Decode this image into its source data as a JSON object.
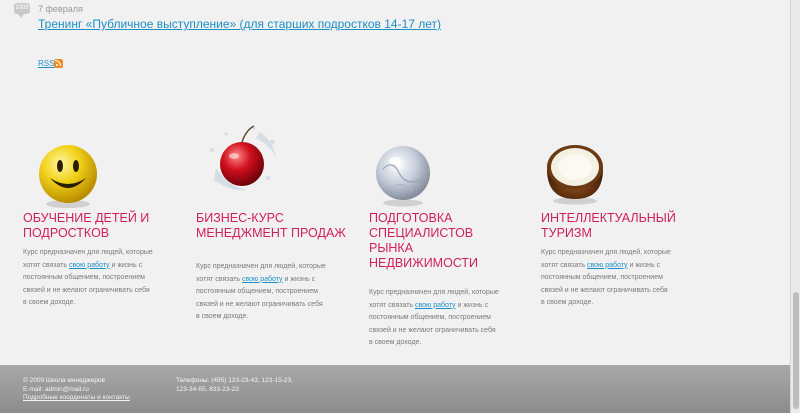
{
  "news": {
    "badge": "2009",
    "date": "7 февраля",
    "title": "Тренинг «Публичное выступление» (для старших подростков 14-17 лет)"
  },
  "rss": {
    "label": "RSS",
    "icon": "rss-icon"
  },
  "courses": [
    {
      "icon": "smiley-ball-icon",
      "title": "Обучение детей и подростков",
      "text_before": "Курс предназначен для людей, которые хотят связать ",
      "link": "свою работу",
      "text_after": " и жизнь с постоянным общением, построением связей и не желают ограничивать себя в своем доходе."
    },
    {
      "icon": "cherry-splash-icon",
      "title": "Бизнес-курс менеджмент продаж",
      "text_before": "Курс предназначен для людей, которые хотят связать ",
      "link": "свою работу",
      "text_after": " и жизнь с постоянным общением, построением связей и не желают ограничивать себя в своем доходе."
    },
    {
      "icon": "ice-ball-icon",
      "title": "Подготовка специалистов рынка недвижимости",
      "text_before": "Курс предназначен для людей, которые хотят связать ",
      "link": "свою работу",
      "text_after": " и жизнь с постоянным общением, построением связей и не желают ограничивать себя в своем доходе."
    },
    {
      "icon": "coconut-icon",
      "title": "Интеллектуальный туризм",
      "text_before": "Курс предназначен для людей, которые хотят связать ",
      "link": "свою работу",
      "text_after": " и жизнь с постоянным общением, построением связей и не желают ограничивать себя в своем доходе."
    }
  ],
  "footer": {
    "copyright": "© 2009 Школа менеджеров",
    "email": "E-mail: admin@mail.ru",
    "contacts_link": "Подробные координаты и контакты",
    "phones_1": "Телефоны: (495) 123-23-43, 123-15-23,",
    "phones_2": "123-34-65, 833-23-23"
  }
}
